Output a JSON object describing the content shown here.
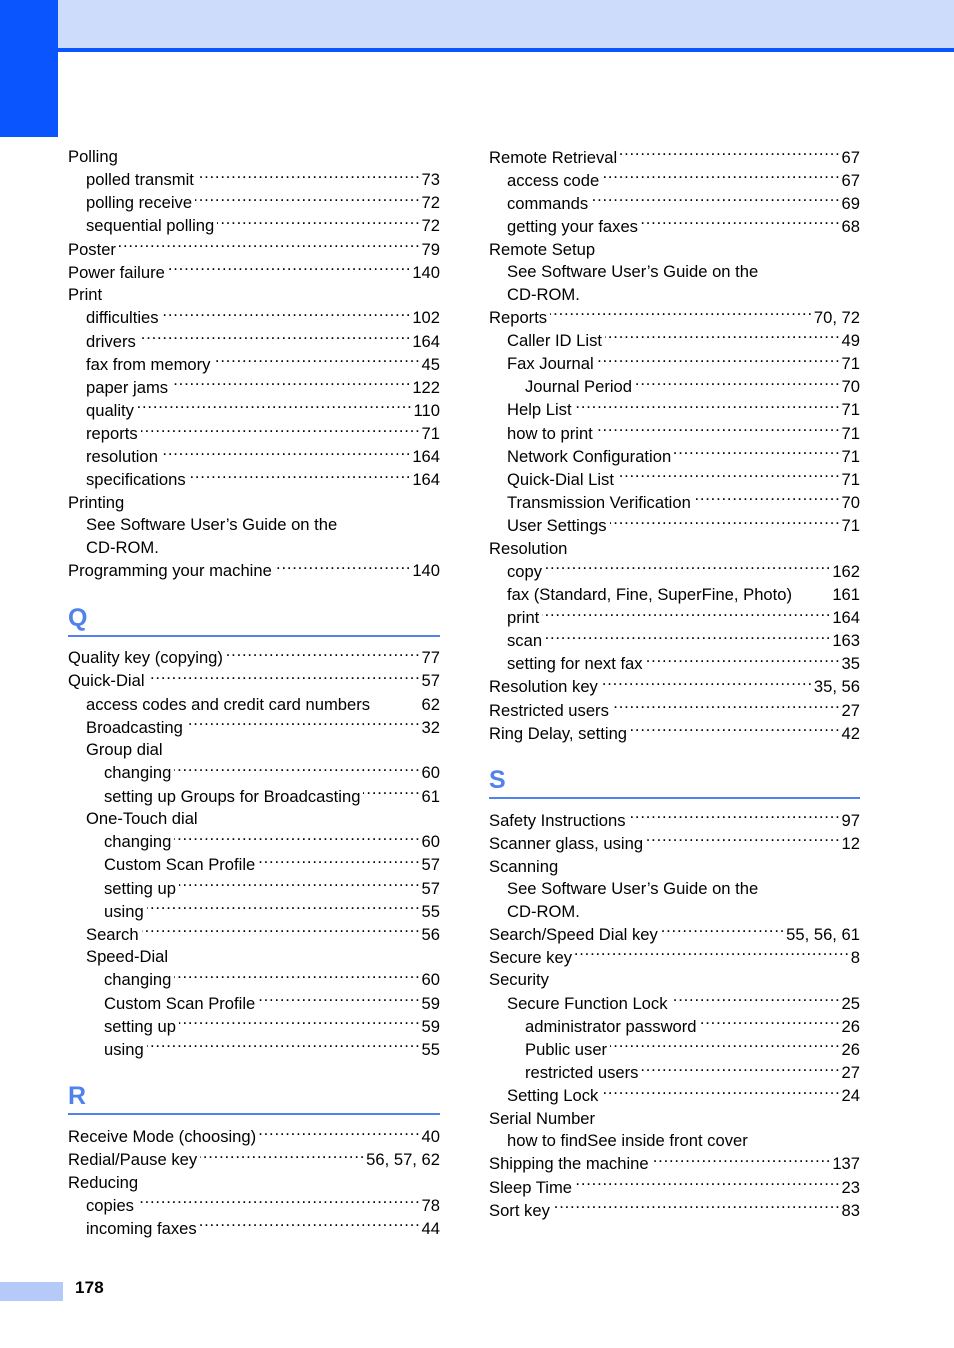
{
  "page": {
    "number": "178",
    "accent_dark_blue": "#0a55fd",
    "accent_light_blue": "#cedcfb",
    "section_letter_blue": "#5181ec",
    "footer_bar_blue": "#b5caf8"
  },
  "columns": {
    "left": {
      "blocks": [
        {
          "type": "entries",
          "entries": [
            {
              "label": "Polling",
              "page": "",
              "level": 0,
              "leader": false
            },
            {
              "label": "polled transmit",
              "page": "73",
              "level": 1,
              "leader": true
            },
            {
              "label": "polling receive",
              "page": "72",
              "level": 1,
              "leader": true
            },
            {
              "label": "sequential polling",
              "page": "72",
              "level": 1,
              "leader": true
            },
            {
              "label": "Poster",
              "page": "79",
              "level": 0,
              "leader": true
            },
            {
              "label": "Power failure",
              "page": "140",
              "level": 0,
              "leader": true
            },
            {
              "label": "Print",
              "page": "",
              "level": 0,
              "leader": false
            },
            {
              "label": "difficulties",
              "page": "102",
              "level": 1,
              "leader": true
            },
            {
              "label": "drivers",
              "page": "164",
              "level": 1,
              "leader": true
            },
            {
              "label": "fax from memory",
              "page": "45",
              "level": 1,
              "leader": true
            },
            {
              "label": "paper jams",
              "page": "122",
              "level": 1,
              "leader": true
            },
            {
              "label": "quality",
              "page": "110",
              "level": 1,
              "leader": true
            },
            {
              "label": "reports",
              "page": "71",
              "level": 1,
              "leader": true
            },
            {
              "label": "resolution",
              "page": "164",
              "level": 1,
              "leader": true
            },
            {
              "label": "specifications",
              "page": "164",
              "level": 1,
              "leader": true
            },
            {
              "label": "Printing",
              "page": "",
              "level": 0,
              "leader": false
            },
            {
              "label": "See Software User’s Guide on the",
              "page": "",
              "level": 1,
              "leader": false
            },
            {
              "label": "CD-ROM.",
              "page": "",
              "level": 1,
              "leader": false
            },
            {
              "label": "Programming your machine",
              "page": "140",
              "level": 0,
              "leader": true
            }
          ]
        },
        {
          "type": "section",
          "letter": "Q",
          "entries": [
            {
              "label": "Quality key (copying)",
              "page": "77",
              "level": 0,
              "leader": true
            },
            {
              "label": "Quick-Dial",
              "page": "57",
              "level": 0,
              "leader": true
            },
            {
              "label": "access codes and credit card numbers",
              "page": "62",
              "level": 1,
              "leader": false
            },
            {
              "label": "Broadcasting",
              "page": "32",
              "level": 1,
              "leader": true
            },
            {
              "label": "Group dial",
              "page": "",
              "level": 1,
              "leader": false
            },
            {
              "label": "changing",
              "page": "60",
              "level": 2,
              "leader": true
            },
            {
              "label": "setting up Groups for Broadcasting",
              "page": "61",
              "level": 2,
              "leader": true
            },
            {
              "label": "One-Touch dial",
              "page": "",
              "level": 1,
              "leader": false
            },
            {
              "label": "changing",
              "page": "60",
              "level": 2,
              "leader": true
            },
            {
              "label": "Custom Scan Profile",
              "page": "57",
              "level": 2,
              "leader": true
            },
            {
              "label": "setting up",
              "page": "57",
              "level": 2,
              "leader": true
            },
            {
              "label": "using",
              "page": "55",
              "level": 2,
              "leader": true
            },
            {
              "label": "Search",
              "page": "56",
              "level": 1,
              "leader": true
            },
            {
              "label": "Speed-Dial",
              "page": "",
              "level": 1,
              "leader": false
            },
            {
              "label": "changing",
              "page": "60",
              "level": 2,
              "leader": true
            },
            {
              "label": "Custom Scan Profile",
              "page": "59",
              "level": 2,
              "leader": true
            },
            {
              "label": "setting up",
              "page": "59",
              "level": 2,
              "leader": true
            },
            {
              "label": "using",
              "page": "55",
              "level": 2,
              "leader": true
            }
          ]
        },
        {
          "type": "section",
          "letter": "R",
          "entries": [
            {
              "label": "Receive Mode (choosing)",
              "page": "40",
              "level": 0,
              "leader": true
            },
            {
              "label": "Redial/Pause key",
              "page": "56, 57, 62",
              "level": 0,
              "leader": true
            },
            {
              "label": "Reducing",
              "page": "",
              "level": 0,
              "leader": false
            },
            {
              "label": "copies",
              "page": "78",
              "level": 1,
              "leader": true
            },
            {
              "label": "incoming faxes",
              "page": "44",
              "level": 1,
              "leader": true
            }
          ]
        }
      ]
    },
    "right": {
      "blocks": [
        {
          "type": "entries",
          "entries": [
            {
              "label": "Remote Retrieval",
              "page": "67",
              "level": 0,
              "leader": true
            },
            {
              "label": "access code",
              "page": "67",
              "level": 1,
              "leader": true
            },
            {
              "label": "commands",
              "page": "69",
              "level": 1,
              "leader": true
            },
            {
              "label": "getting your faxes",
              "page": "68",
              "level": 1,
              "leader": true
            },
            {
              "label": "Remote Setup",
              "page": "",
              "level": 0,
              "leader": false
            },
            {
              "label": "See Software User’s Guide on the",
              "page": "",
              "level": 1,
              "leader": false
            },
            {
              "label": "CD-ROM.",
              "page": "",
              "level": 1,
              "leader": false
            },
            {
              "label": "Reports",
              "page": "70, 72",
              "level": 0,
              "leader": true
            },
            {
              "label": "Caller ID List",
              "page": "49",
              "level": 1,
              "leader": true
            },
            {
              "label": "Fax Journal",
              "page": "71",
              "level": 1,
              "leader": true
            },
            {
              "label": "Journal Period",
              "page": "70",
              "level": 2,
              "leader": true
            },
            {
              "label": "Help List",
              "page": "71",
              "level": 1,
              "leader": true
            },
            {
              "label": "how to print",
              "page": "71",
              "level": 1,
              "leader": true
            },
            {
              "label": "Network Configuration",
              "page": "71",
              "level": 1,
              "leader": true
            },
            {
              "label": "Quick-Dial List",
              "page": "71",
              "level": 1,
              "leader": true
            },
            {
              "label": "Transmission Verification",
              "page": "70",
              "level": 1,
              "leader": true
            },
            {
              "label": "User Settings",
              "page": "71",
              "level": 1,
              "leader": true
            },
            {
              "label": "Resolution",
              "page": "",
              "level": 0,
              "leader": false
            },
            {
              "label": "copy",
              "page": "162",
              "level": 1,
              "leader": true
            },
            {
              "label": "fax (Standard, Fine, SuperFine, Photo)",
              "page": "161",
              "level": 1,
              "leader": false
            },
            {
              "label": "print",
              "page": "164",
              "level": 1,
              "leader": true
            },
            {
              "label": "scan",
              "page": "163",
              "level": 1,
              "leader": true
            },
            {
              "label": "setting for next fax",
              "page": "35",
              "level": 1,
              "leader": true
            },
            {
              "label": "Resolution key",
              "page": "35, 56",
              "level": 0,
              "leader": true
            },
            {
              "label": "Restricted users",
              "page": "27",
              "level": 0,
              "leader": true
            },
            {
              "label": "Ring Delay, setting",
              "page": "42",
              "level": 0,
              "leader": true
            }
          ]
        },
        {
          "type": "section",
          "letter": "S",
          "entries": [
            {
              "label": "Safety Instructions",
              "page": "97",
              "level": 0,
              "leader": true
            },
            {
              "label": "Scanner glass, using",
              "page": "12",
              "level": 0,
              "leader": true
            },
            {
              "label": "Scanning",
              "page": "",
              "level": 0,
              "leader": false
            },
            {
              "label": "See Software User’s Guide on the",
              "page": "",
              "level": 1,
              "leader": false
            },
            {
              "label": "CD-ROM.",
              "page": "",
              "level": 1,
              "leader": false
            },
            {
              "label": "Search/Speed Dial key",
              "page": "55, 56, 61",
              "level": 0,
              "leader": true
            },
            {
              "label": "Secure key",
              "page": "8",
              "level": 0,
              "leader": true
            },
            {
              "label": "Security",
              "page": "",
              "level": 0,
              "leader": false
            },
            {
              "label": "Secure Function Lock",
              "page": "25",
              "level": 1,
              "leader": true
            },
            {
              "label": "administrator password",
              "page": "26",
              "level": 2,
              "leader": true
            },
            {
              "label": "Public user",
              "page": "26",
              "level": 2,
              "leader": true
            },
            {
              "label": "restricted users",
              "page": "27",
              "level": 2,
              "leader": true
            },
            {
              "label": "Setting Lock",
              "page": "24",
              "level": 1,
              "leader": true
            },
            {
              "label": "Serial Number",
              "page": "",
              "level": 0,
              "leader": false
            },
            {
              "label": "how to findSee inside front cover",
              "page": "",
              "level": 1,
              "leader": false
            },
            {
              "label": "Shipping the machine",
              "page": "137",
              "level": 0,
              "leader": true
            },
            {
              "label": "Sleep Time",
              "page": "23",
              "level": 0,
              "leader": true
            },
            {
              "label": "Sort key",
              "page": "83",
              "level": 0,
              "leader": true
            }
          ]
        }
      ]
    }
  }
}
